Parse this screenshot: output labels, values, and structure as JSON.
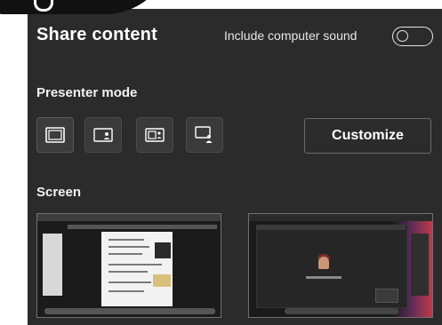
{
  "header": {
    "title": "Share content",
    "include_sound_label": "Include computer sound",
    "include_sound_on": false
  },
  "presenter": {
    "label": "Presenter mode",
    "modes": [
      {
        "icon": "content-only-icon",
        "selected": true
      },
      {
        "icon": "standout-icon",
        "selected": false
      },
      {
        "icon": "side-by-side-icon",
        "selected": false
      },
      {
        "icon": "reporter-icon",
        "selected": false
      }
    ],
    "customize_label": "Customize"
  },
  "screen": {
    "label": "Screen",
    "thumbnails": [
      {
        "icon": "document-screen-thumbnail"
      },
      {
        "icon": "meeting-screen-thumbnail"
      }
    ]
  },
  "colors": {
    "panel_bg": "#2b2b2b",
    "text": "#ffffff",
    "border": "#6a6a6a"
  }
}
